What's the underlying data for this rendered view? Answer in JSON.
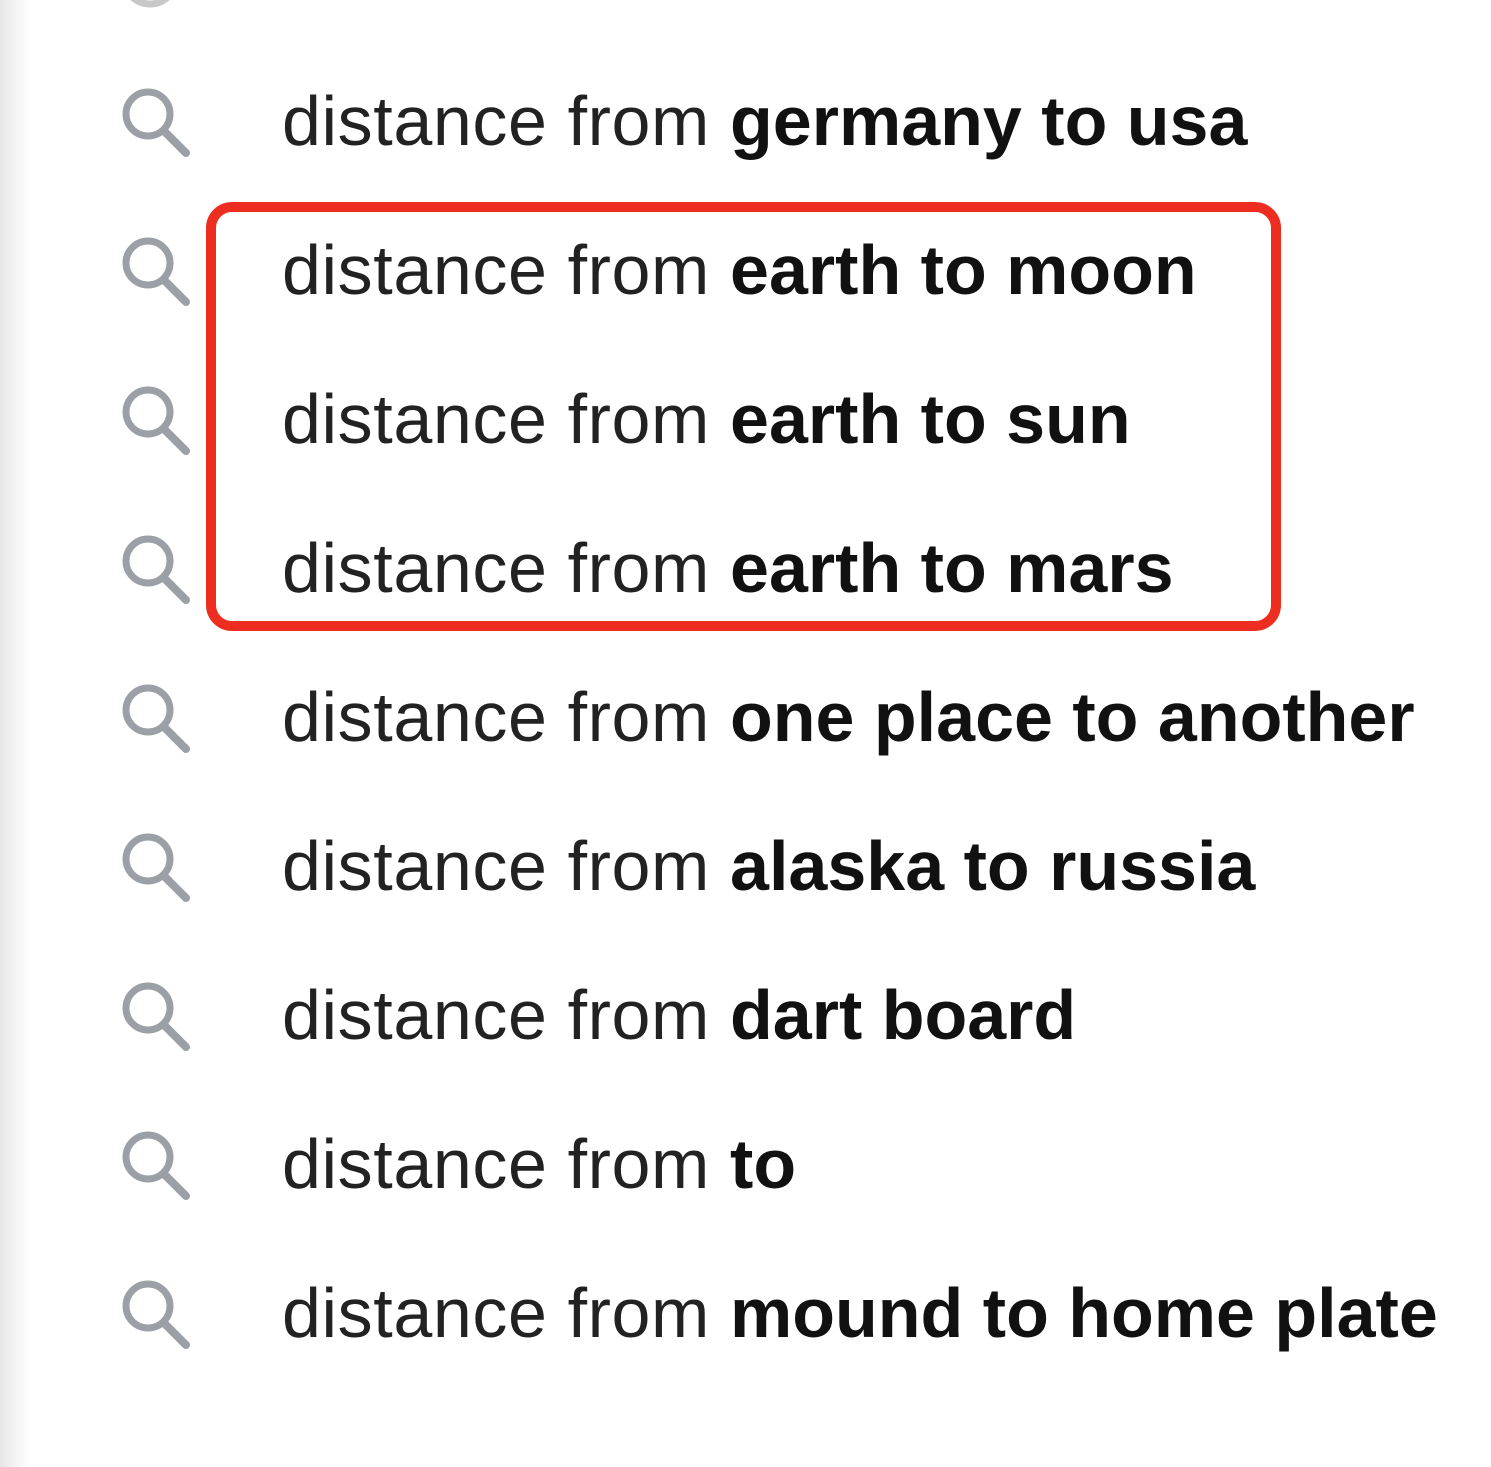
{
  "autocomplete": {
    "cut_off_row": {
      "icon": "history-icon"
    },
    "suggestions": [
      {
        "prefix": "distance from ",
        "completion": "germany to usa",
        "icon": "search-icon"
      },
      {
        "prefix": "distance from ",
        "completion": "earth to moon",
        "icon": "search-icon"
      },
      {
        "prefix": "distance from ",
        "completion": "earth to sun",
        "icon": "search-icon"
      },
      {
        "prefix": "distance from ",
        "completion": "earth to mars",
        "icon": "search-icon"
      },
      {
        "prefix": "distance from ",
        "completion": "one place to another",
        "icon": "search-icon"
      },
      {
        "prefix": "distance from ",
        "completion": "alaska to russia",
        "icon": "search-icon"
      },
      {
        "prefix": "distance from ",
        "completion": "dart board",
        "icon": "search-icon"
      },
      {
        "prefix": "distance from ",
        "completion": "to",
        "icon": "search-icon"
      },
      {
        "prefix": "distance from ",
        "completion": "mound to home plate",
        "icon": "search-icon"
      }
    ]
  },
  "annotation": {
    "color": "#ec2d1f"
  },
  "colors": {
    "text": "#222222",
    "completion_text": "#111111",
    "icon": "#9aa0a6",
    "visited_link": "#52188c",
    "background": "#ffffff"
  }
}
